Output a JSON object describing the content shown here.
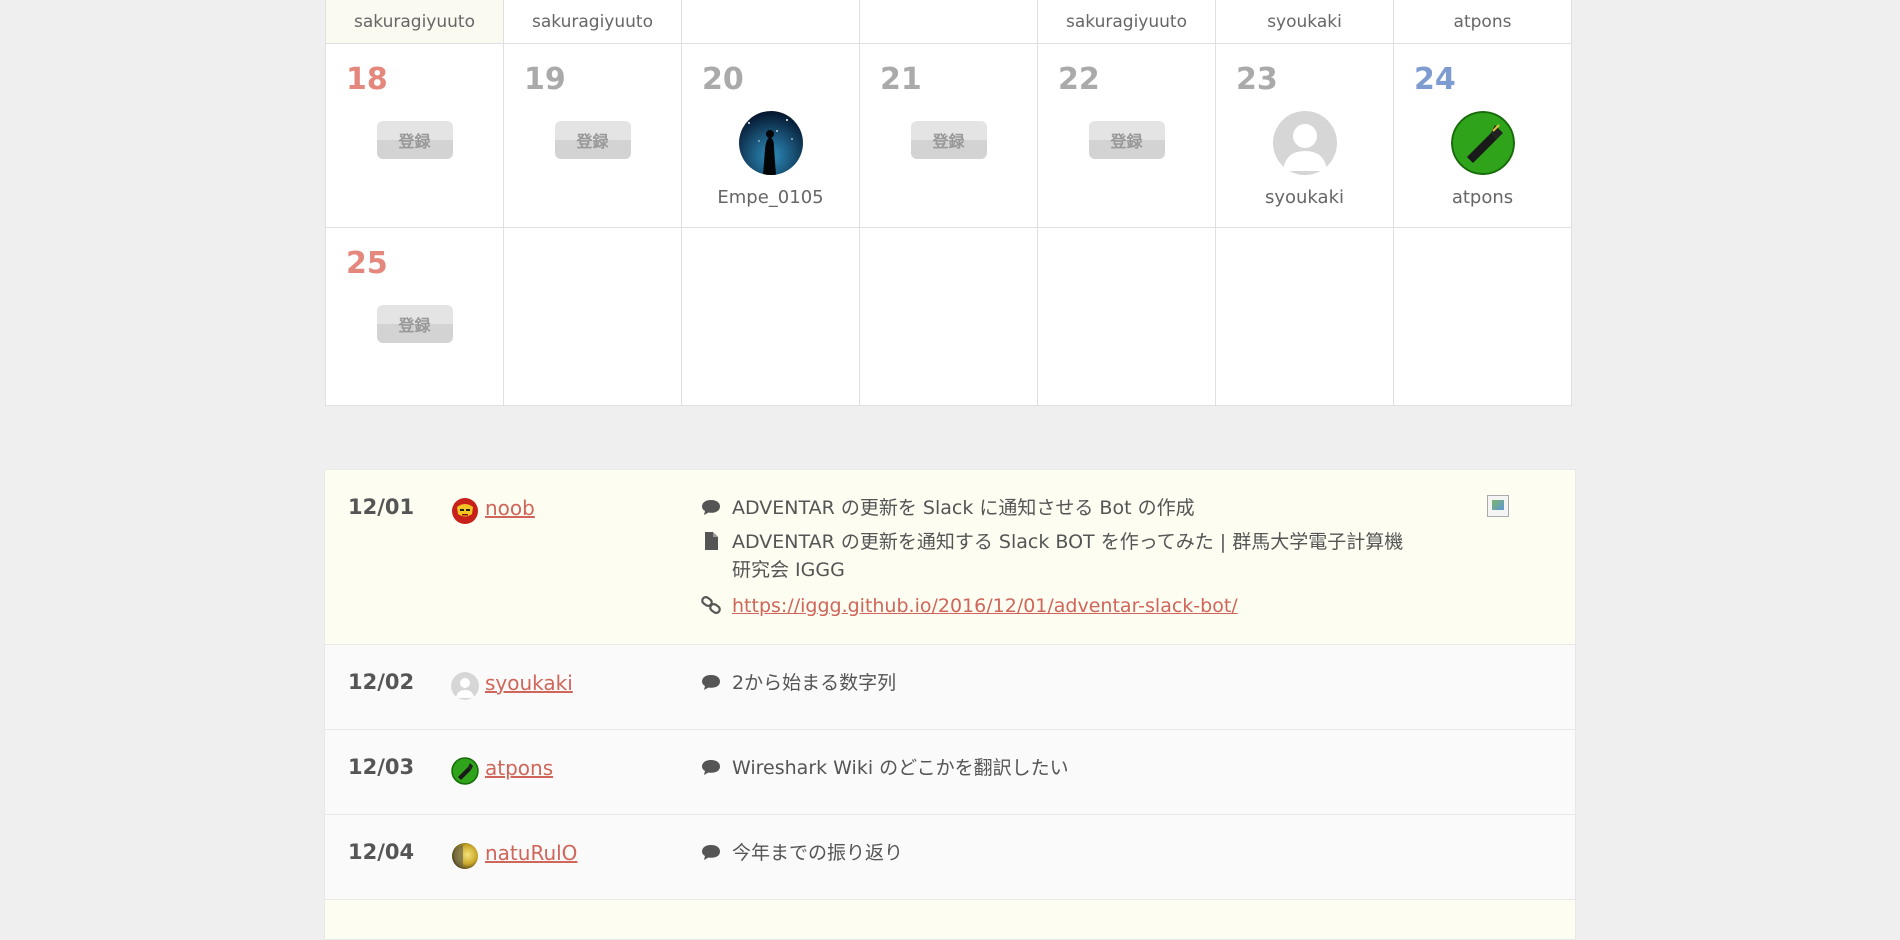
{
  "calendar": {
    "top_names": [
      "sakuragiyuuto",
      "sakuragiyuuto",
      "",
      "",
      "sakuragiyuuto",
      "syoukaki",
      "atpons"
    ],
    "register_label": "登録",
    "week4": [
      {
        "day": "18",
        "state": "register"
      },
      {
        "day": "19",
        "state": "register"
      },
      {
        "day": "20",
        "state": "user",
        "user": "Empe_0105",
        "avatar": "night-sky-silhouette"
      },
      {
        "day": "21",
        "state": "register"
      },
      {
        "day": "22",
        "state": "register"
      },
      {
        "day": "23",
        "state": "user",
        "user": "syoukaki",
        "avatar": "default-gray-person"
      },
      {
        "day": "24",
        "state": "user",
        "user": "atpons",
        "avatar": "green-pen"
      }
    ],
    "week5": [
      {
        "day": "25",
        "state": "register"
      }
    ],
    "colors": {
      "sunday": "#e4877d",
      "saturday": "#7f9cd0",
      "weekday": "#aaaaaa"
    }
  },
  "entries": [
    {
      "date": "12/01",
      "user": "noob",
      "avatar": "red-yellow-helmet",
      "comment": "ADVENTAR の更新を Slack に通知させる Bot の作成",
      "title": "ADVENTAR の更新を通知する Slack BOT を作ってみた | 群馬大学電子計算機研究会 IGGG",
      "url": "https://iggg.github.io/2016/12/01/adventar-slack-bot/"
    },
    {
      "date": "12/02",
      "user": "syoukaki",
      "avatar": "default-gray-person",
      "comment": "2から始まる数字列"
    },
    {
      "date": "12/03",
      "user": "atpons",
      "avatar": "green-pen",
      "comment": "Wireshark Wiki のどこかを翻訳したい"
    },
    {
      "date": "12/04",
      "user": "natuRulO",
      "avatar": "yellow-sphere",
      "comment": "今年までの振り返り"
    }
  ],
  "icons": {
    "comment": "speech-bubble-icon",
    "document": "document-icon",
    "link": "chain-link-icon"
  },
  "link_color": "#d0655a"
}
